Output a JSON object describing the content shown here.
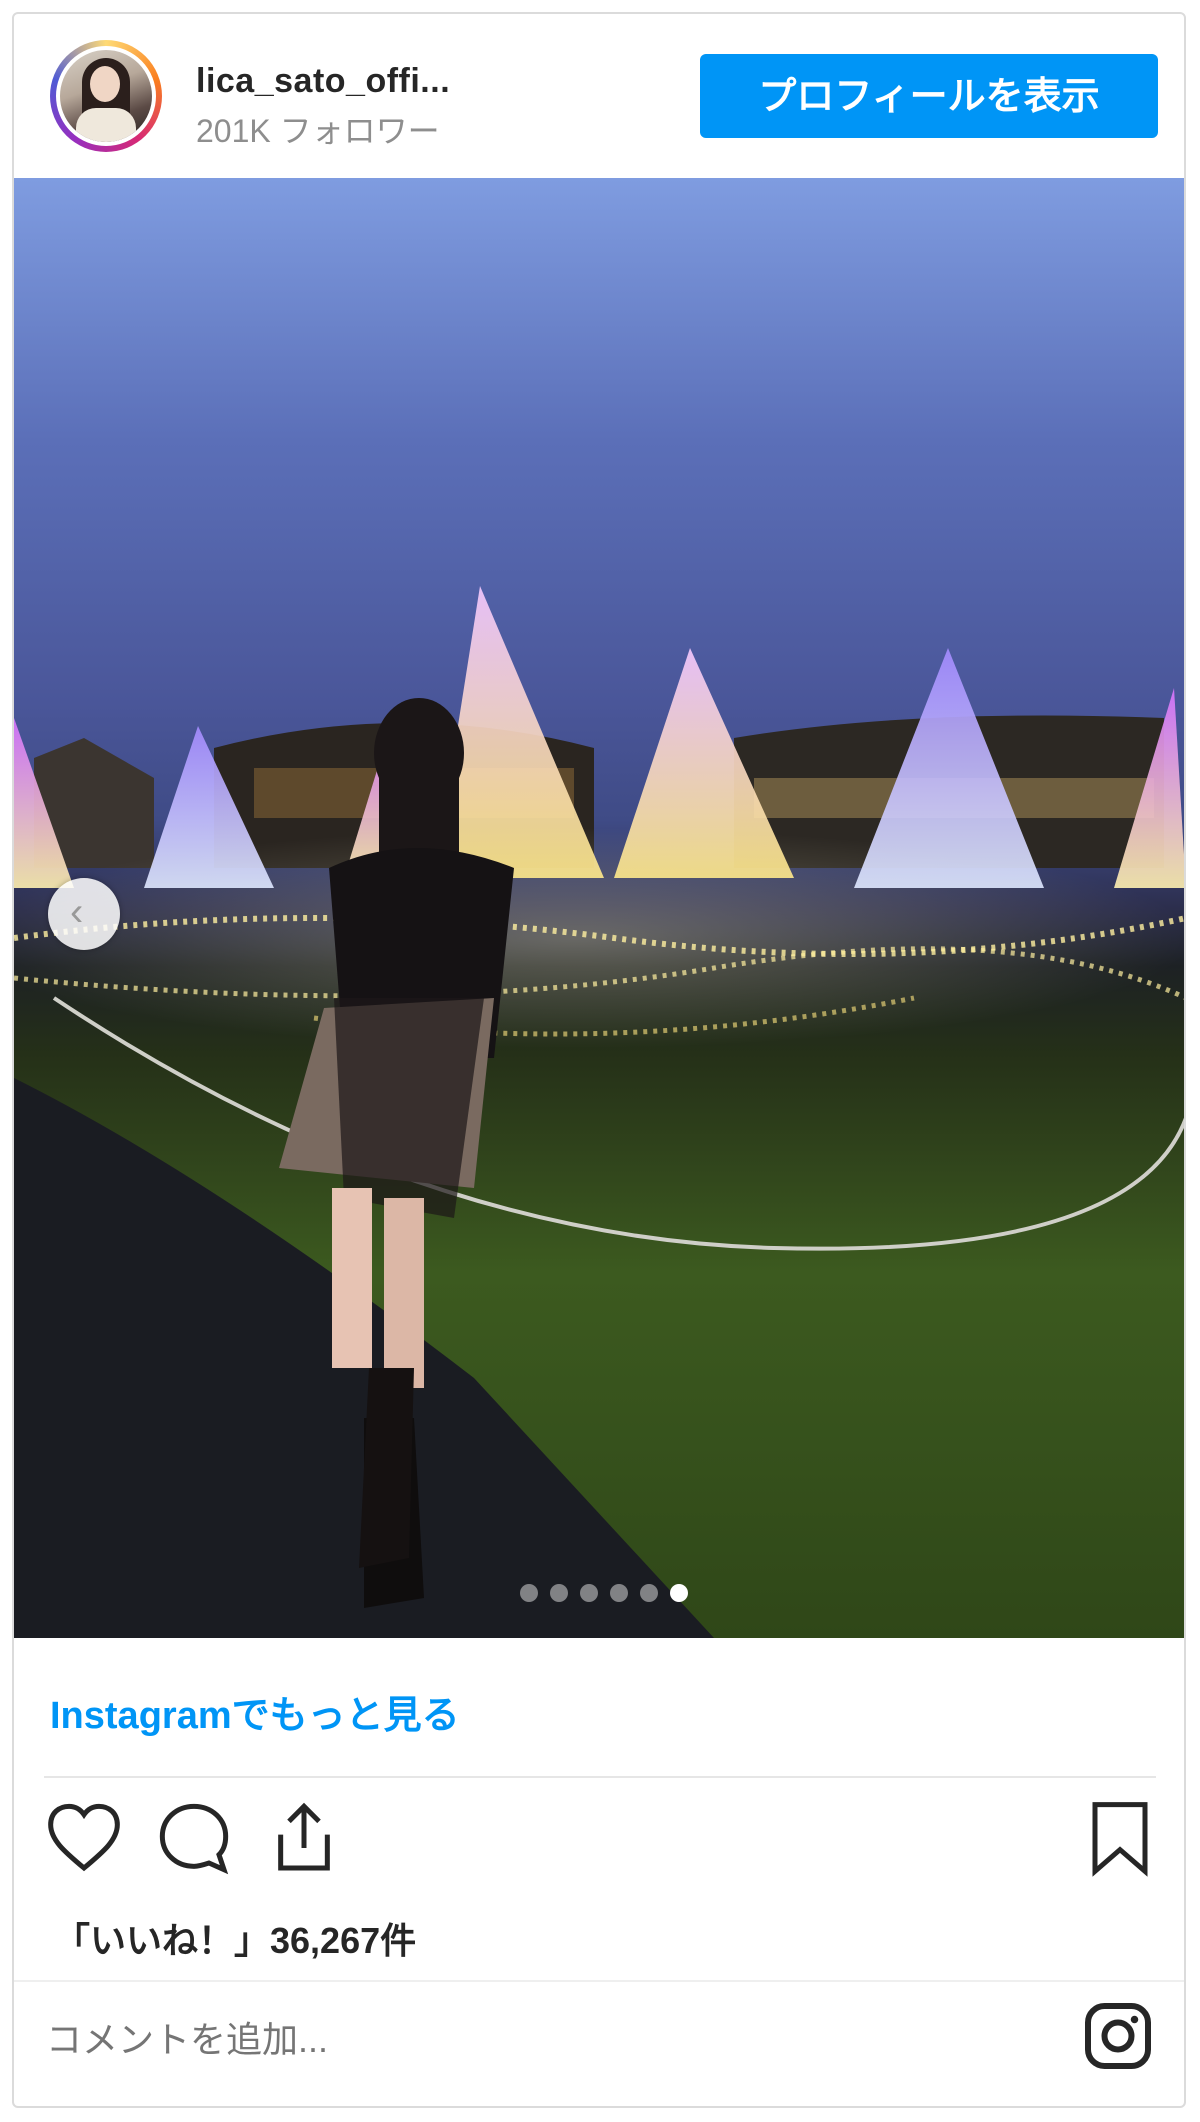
{
  "header": {
    "username": "lica_sato_offi...",
    "followers": "201K フォロワー",
    "profile_button": "プロフィールを表示"
  },
  "photo": {
    "carousel_total": 6,
    "carousel_active_index": 6
  },
  "footer": {
    "more_link": "Instagramでもっと見る",
    "likes": "「いいね！」36,267件",
    "comment_placeholder": "コメントを追加..."
  },
  "icons": [
    "heart-icon",
    "comment-icon",
    "share-icon",
    "bookmark-icon",
    "instagram-icon",
    "chevron-left-icon"
  ],
  "colors": {
    "accent": "#0095f6",
    "text": "#262626",
    "muted": "#8e8e8e"
  }
}
